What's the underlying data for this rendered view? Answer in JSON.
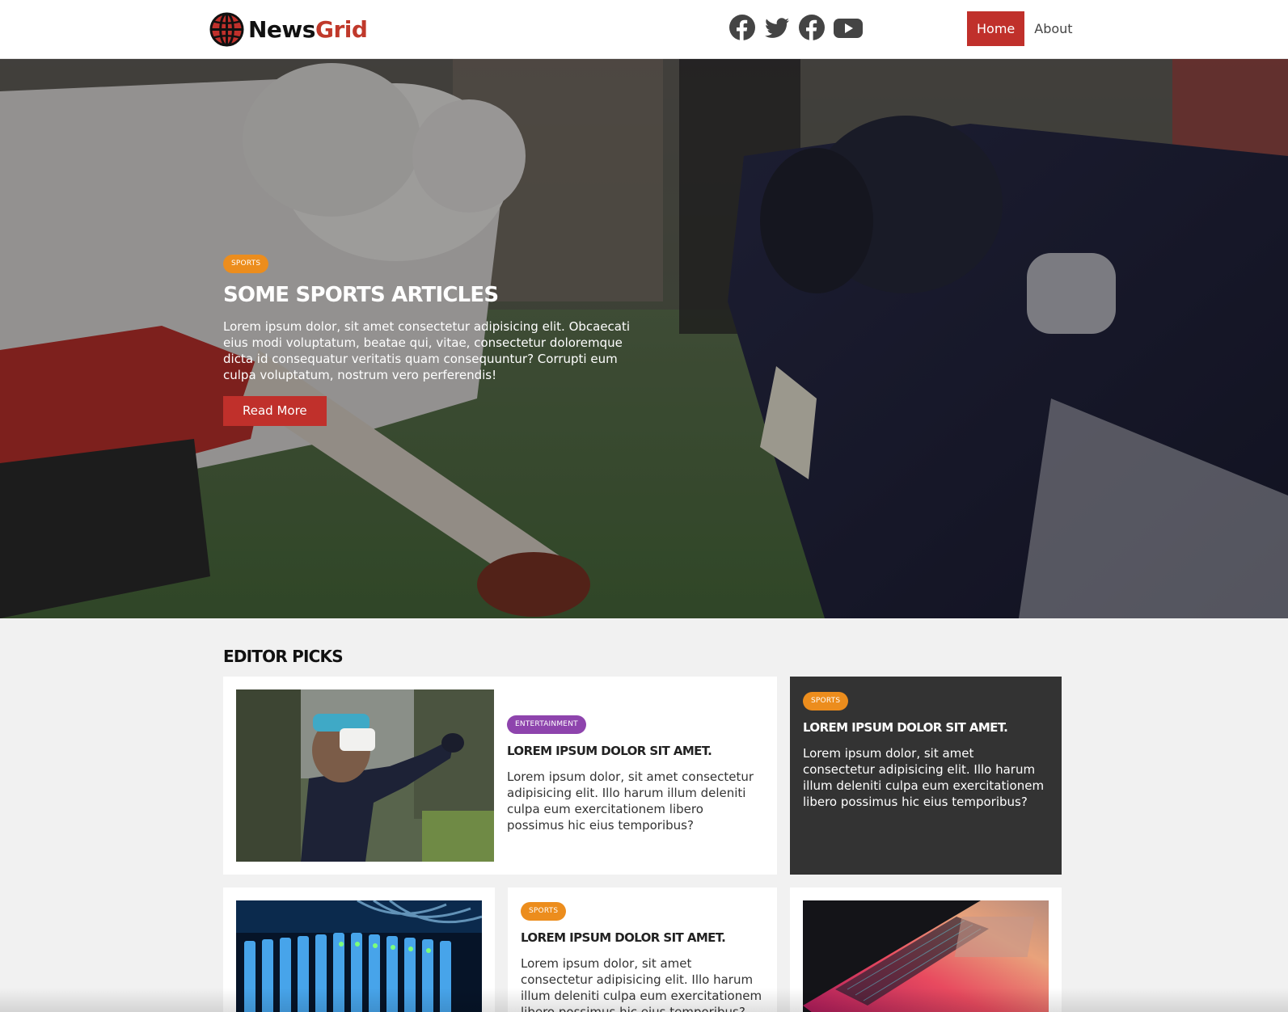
{
  "brand": {
    "name_part1": "News",
    "name_part2": "Grid",
    "accent_color": "#c0302b"
  },
  "social": [
    {
      "icon": "facebook-icon"
    },
    {
      "icon": "twitter-icon"
    },
    {
      "icon": "facebook-icon"
    },
    {
      "icon": "youtube-icon"
    }
  ],
  "nav": {
    "items": [
      {
        "label": "Home",
        "active": true
      },
      {
        "label": "About",
        "active": false
      }
    ]
  },
  "hero": {
    "category": "Sports",
    "title": "Some Sports Articles",
    "text": "Lorem ipsum dolor, sit amet consectetur adipisicing elit. Obcaecati eius modi voluptatum, beatae qui, vitae, consectetur doloremque dicta id consequatur veritatis quam consequuntur? Corrupti eum culpa voluptatum, nostrum vero perferendis!",
    "button_label": "Read More"
  },
  "editor_picks": {
    "title": "Editor Picks",
    "cards": [
      {
        "category": "Entertainment",
        "title": "Lorem ipsum dolor sit amet.",
        "text": "Lorem ipsum dolor, sit amet consectetur adipisicing elit. Illo harum illum deleniti culpa eum exercitationem libero possimus hic eius temporibus?"
      },
      {
        "category": "Sports",
        "title": "Lorem ipsum dolor sit amet.",
        "text": "Lorem ipsum dolor, sit amet consectetur adipisicing elit. Illo harum illum deleniti culpa eum exercitationem libero possimus hic eius temporibus?"
      },
      {
        "category": "Sports",
        "title": "Lorem ipsum dolor sit amet.",
        "text": "Lorem ipsum dolor, sit amet consectetur adipisicing elit. Illo harum illum deleniti culpa eum exercitationem libero possimus hic eius temporibus?"
      }
    ]
  },
  "colors": {
    "sports_badge": "#ec8d1d",
    "entertainment_badge": "#8e44ad",
    "dark_card": "#333333"
  }
}
